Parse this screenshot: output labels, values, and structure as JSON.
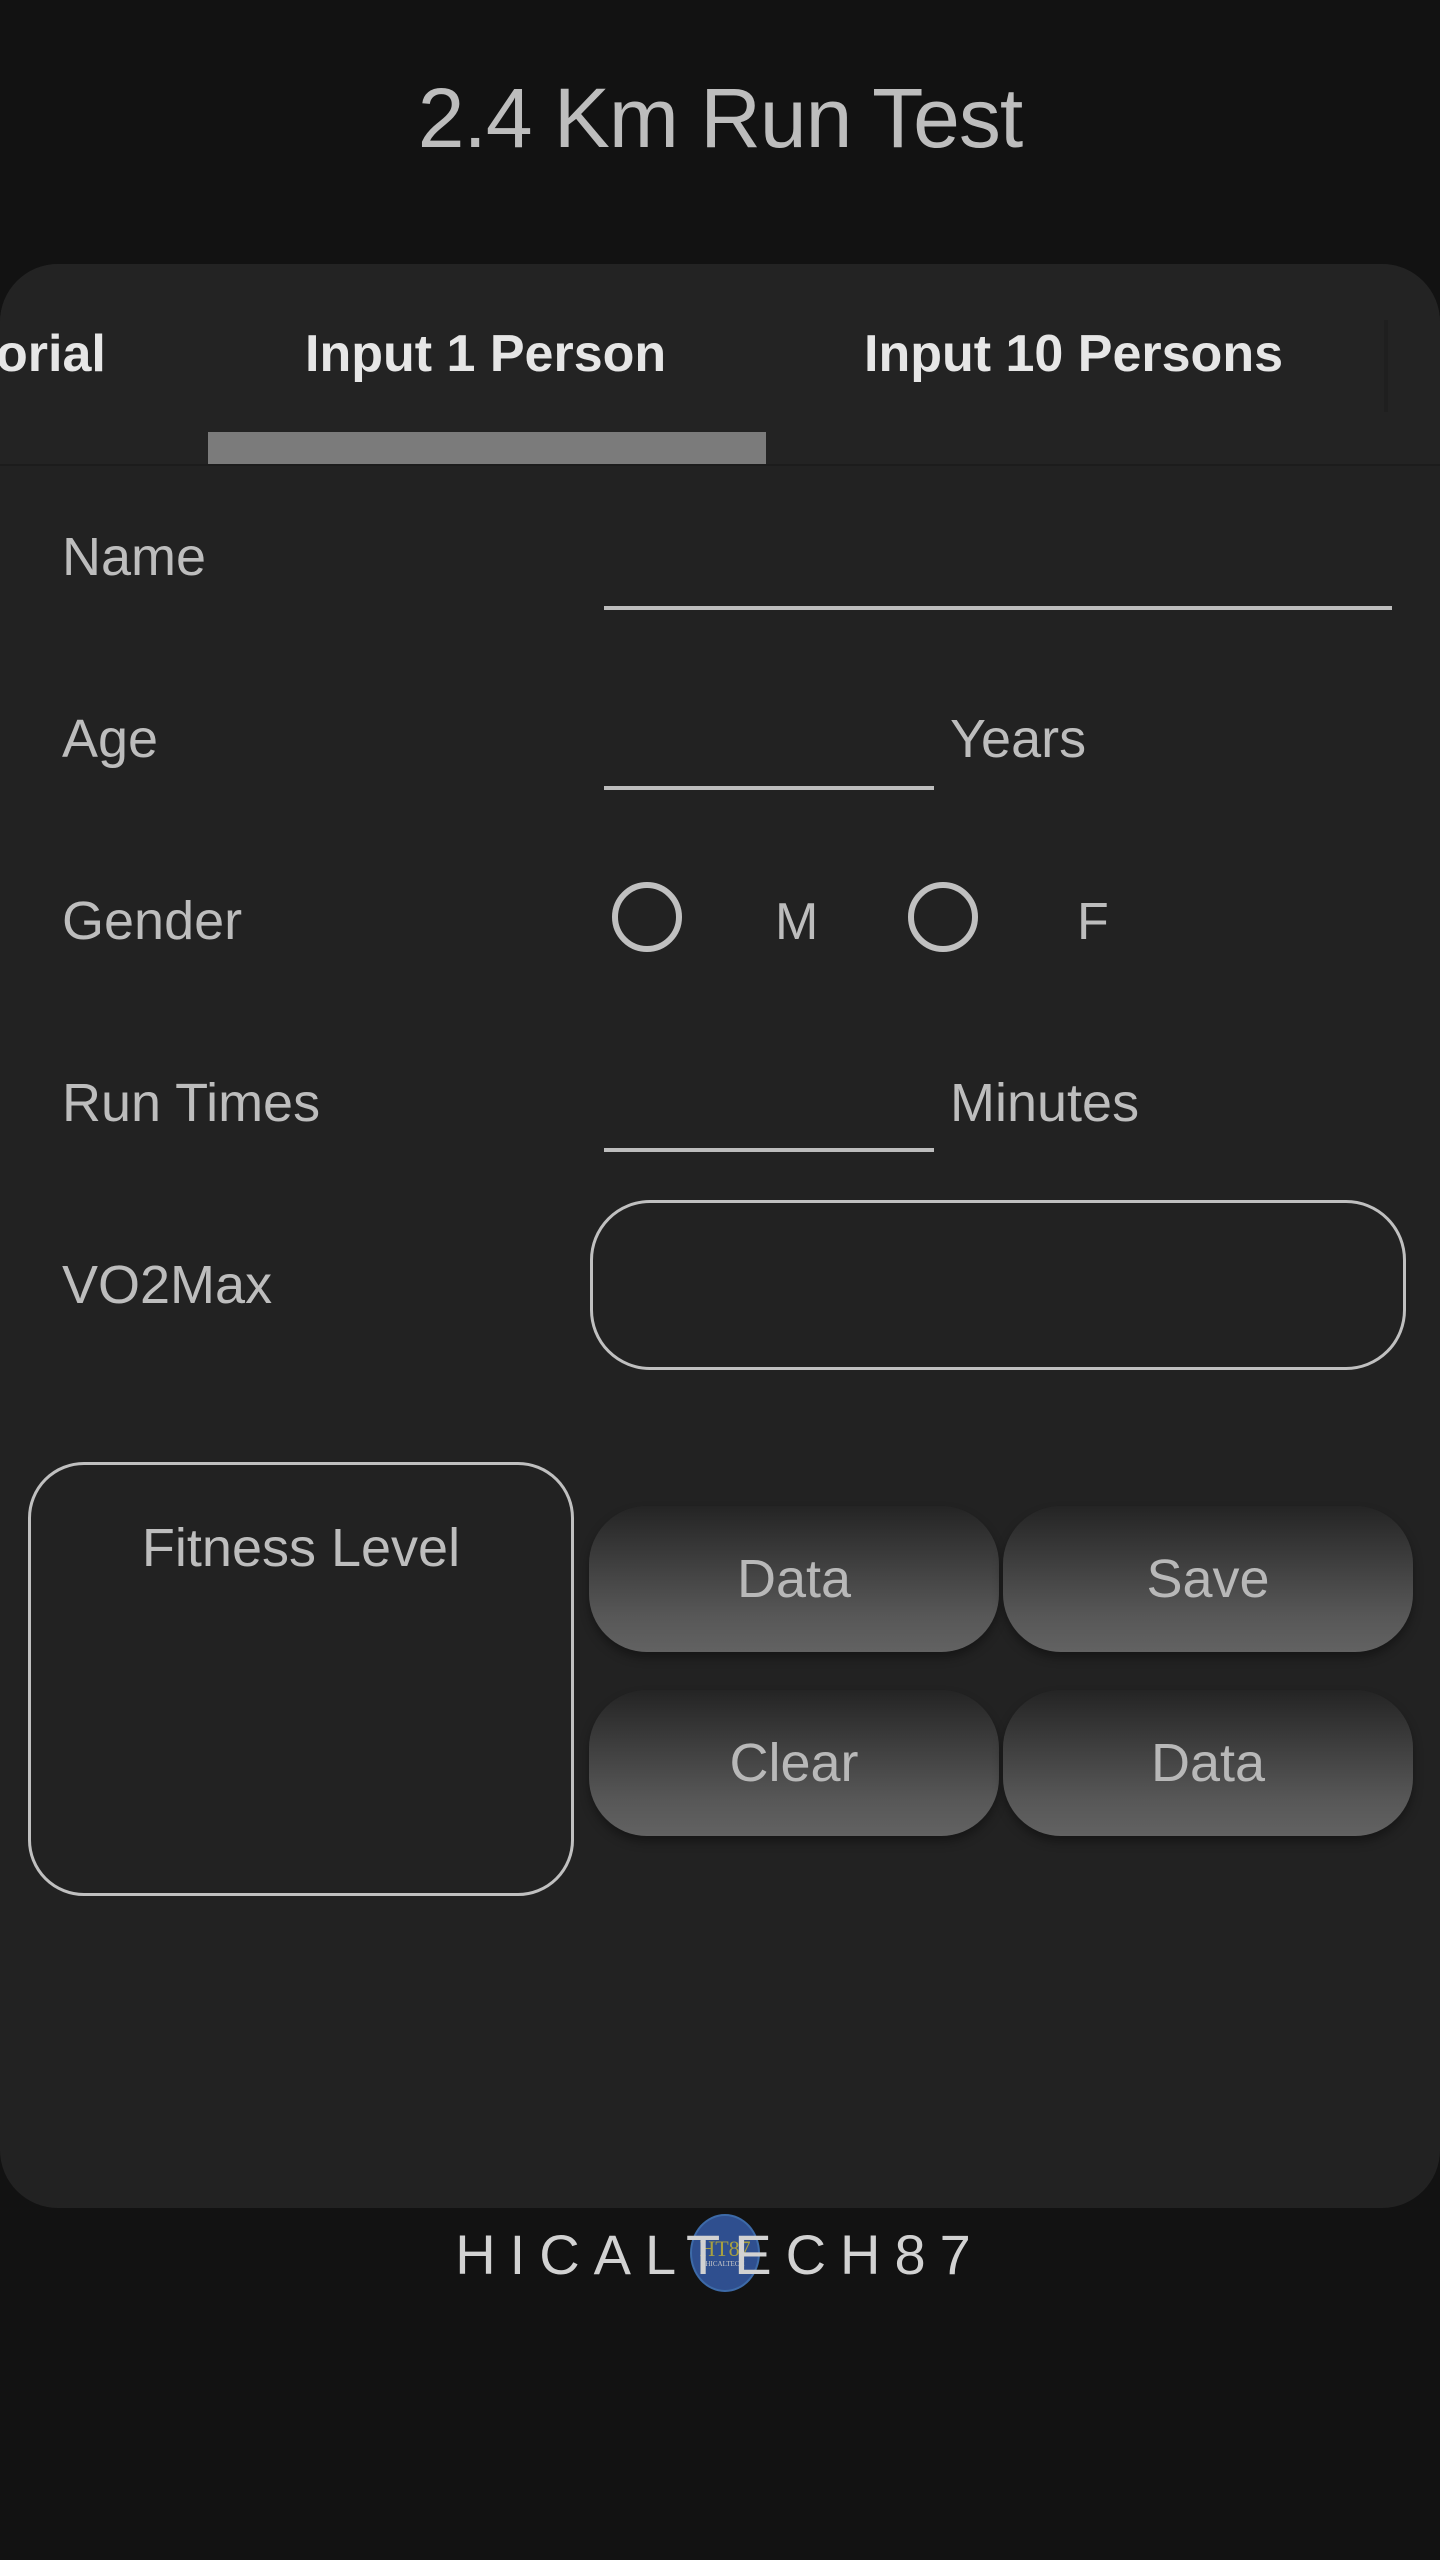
{
  "header": {
    "title": "2.4 Km Run Test"
  },
  "tabs": [
    {
      "label": "orial",
      "active": false
    },
    {
      "label": "Input 1 Person",
      "active": true
    },
    {
      "label": "Input 10 Persons",
      "active": false
    }
  ],
  "form": {
    "name": {
      "label": "Name",
      "value": ""
    },
    "age": {
      "label": "Age",
      "value": "",
      "unit": "Years"
    },
    "gender": {
      "label": "Gender",
      "options": [
        {
          "label": "M",
          "selected": false
        },
        {
          "label": "F",
          "selected": false
        }
      ]
    },
    "run_times": {
      "label": "Run Times",
      "value": "",
      "unit": "Minutes"
    },
    "vo2max": {
      "label": "VO2Max",
      "value": ""
    }
  },
  "fitness_level": {
    "title": "Fitness Level",
    "value": ""
  },
  "buttons": {
    "data_top": "Data",
    "save": "Save",
    "clear": "Clear",
    "data_bottom": "Data"
  },
  "footer": {
    "brand": "HICALTECH87",
    "logo_text": "HT87",
    "logo_subtext": "HICALTECH"
  },
  "colors": {
    "background": "#121212",
    "card": "#222222",
    "text": "#bdbdbd",
    "tab_indicator": "#7b7b7b",
    "logo_blue": "#2f4f8f"
  }
}
